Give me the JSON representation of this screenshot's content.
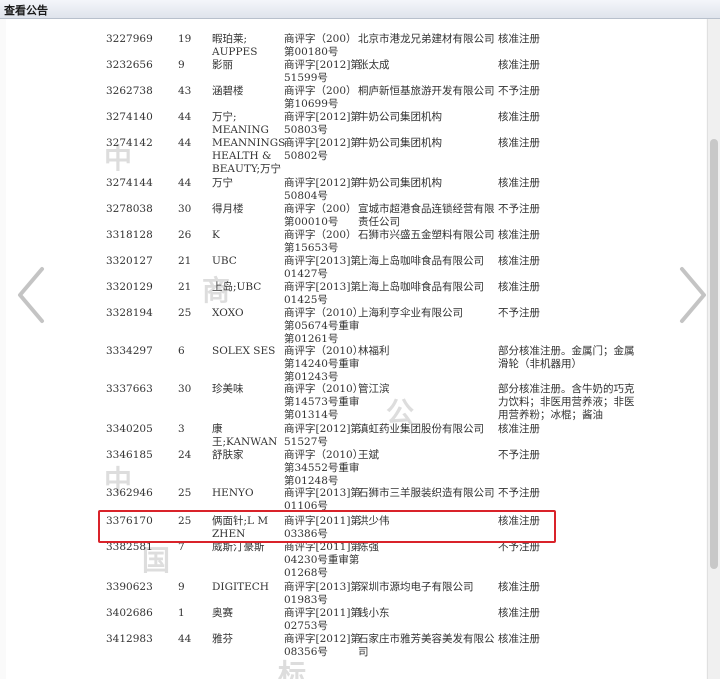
{
  "window": {
    "title": "查看公告"
  },
  "rows": [
    {
      "no": "3227969",
      "cls": "19",
      "mark": "暇珀莱; AUPPES",
      "ref": "商评字（200）第00180号",
      "applicant": "北京市港龙兄弟建材有限公司",
      "result": "核准注册"
    },
    {
      "no": "3232656",
      "cls": "9",
      "mark": "影丽",
      "ref": "商评字[2012]第51599号",
      "applicant": "张太成",
      "result": "核准注册"
    },
    {
      "no": "3262738",
      "cls": "43",
      "mark": "涵碧楼",
      "ref": "商评字（200）第10699号",
      "applicant": "桐庐新恒基旅游开发有限公司",
      "result": "不予注册"
    },
    {
      "no": "3274140",
      "cls": "44",
      "mark": "万宁; MEANING",
      "ref": "商评字[2012]第50803号",
      "applicant": "牛奶公司集团机构",
      "result": "核准注册"
    },
    {
      "no": "3274142",
      "cls": "44",
      "mark": "MEANNINGS HEALTH & BEAUTY;万宁",
      "ref": "商评字[2012]第50802号",
      "applicant": "牛奶公司集团机构",
      "result": "核准注册"
    },
    {
      "no": "3274144",
      "cls": "44",
      "mark": "万宁",
      "ref": "商评字[2012]第50804号",
      "applicant": "牛奶公司集团机构",
      "result": "核准注册"
    },
    {
      "no": "3278038",
      "cls": "30",
      "mark": "得月楼",
      "ref": "商评字（200）第00010号",
      "applicant": "宣城市超港食品连锁经营有限责任公司",
      "result": "不予注册"
    },
    {
      "no": "3318128",
      "cls": "26",
      "mark": "K",
      "ref": "商评字（200）第15653号",
      "applicant": "石狮市兴盛五金塑料有限公司",
      "result": "核准注册"
    },
    {
      "no": "3320127",
      "cls": "21",
      "mark": "UBC",
      "ref": "商评字[2013]第01427号",
      "applicant": "上海上岛咖啡食品有限公司",
      "result": "核准注册"
    },
    {
      "no": "3320129",
      "cls": "21",
      "mark": "上岛;UBC",
      "ref": "商评字[2013]第01425号",
      "applicant": "上海上岛咖啡食品有限公司",
      "result": "核准注册"
    },
    {
      "no": "3328194",
      "cls": "25",
      "mark": "XOXO",
      "ref": "商评字（2010）第05674号重审第01261号",
      "applicant": "上海利亨伞业有限公司",
      "result": "不予注册"
    },
    {
      "no": "3334297",
      "cls": "6",
      "mark": "SOLEX SES",
      "ref": "商评字（2010）第14240号重审第01243号",
      "applicant": "林福利",
      "result": "部分核准注册。金属门；金属滑轮（非机器用）"
    },
    {
      "no": "3337663",
      "cls": "30",
      "mark": "珍美味",
      "ref": "商评字（2010）第14573号重审第01314号",
      "applicant": "管江滨",
      "result": "部分核准注册。含牛奶的巧克力饮料；非医用营养液；非医用营养粉；冰棍；酱油"
    },
    {
      "no": "3340205",
      "cls": "3",
      "mark": "康王;KANWAN",
      "ref": "商评字[2012]第51527号",
      "applicant": "滇虹药业集团股份有限公司",
      "result": "核准注册"
    },
    {
      "no": "3346185",
      "cls": "24",
      "mark": "舒肤家",
      "ref": "商评字（2010）第34552号重审第01248号",
      "applicant": "王斌",
      "result": "不予注册"
    },
    {
      "no": "3362946",
      "cls": "25",
      "mark": "HENYO",
      "ref": "商评字[2013]第01106号",
      "applicant": "石狮市三羊服装织造有限公司",
      "result": "不予注册"
    },
    {
      "no": "3376170",
      "cls": "25",
      "mark": "俩面针;L M ZHEN",
      "ref": "商评字[2011]第03386号",
      "applicant": "洪少伟",
      "result": "核准注册"
    },
    {
      "no": "3382581",
      "cls": "7",
      "mark": "威斯汀豪斯",
      "ref": "商评字[2011]第04230号重审第01268号",
      "applicant": "陈强",
      "result": "不予注册"
    },
    {
      "no": "3390623",
      "cls": "9",
      "mark": "DIGITECH",
      "ref": "商评字[2013]第01983号",
      "applicant": "深圳市源均电子有限公司",
      "result": "核准注册"
    },
    {
      "no": "3402686",
      "cls": "1",
      "mark": "奥赛",
      "ref": "商评字[2011]第02753号",
      "applicant": "钱小东",
      "result": "核准注册"
    },
    {
      "no": "3412983",
      "cls": "44",
      "mark": "雅芬",
      "ref": "商评字[2012]第08356号",
      "applicant": "石家庄市雅芳美容美发有限公司",
      "result": "核准注册"
    }
  ]
}
